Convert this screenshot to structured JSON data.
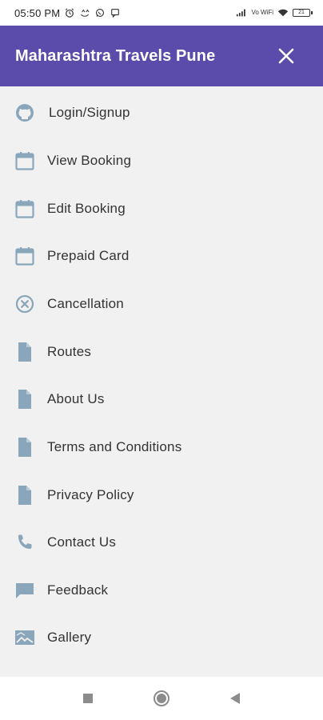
{
  "status_bar": {
    "time": "05:50 PM",
    "network_label": "Vo WiFi",
    "battery_level": "21"
  },
  "app_bar": {
    "title": "Maharashtra Travels Pune",
    "close_icon": "close-icon"
  },
  "colors": {
    "app_bar": "#5b4baa",
    "icon": "#8aa6ba",
    "menu_bg": "#f1f1f1",
    "text": "#333333"
  },
  "menu": {
    "items": [
      {
        "label": "Login/Signup",
        "icon": "github-icon"
      },
      {
        "label": "View Booking",
        "icon": "calendar-icon"
      },
      {
        "label": "Edit Booking",
        "icon": "calendar-icon"
      },
      {
        "label": "Prepaid Card",
        "icon": "calendar-icon"
      },
      {
        "label": "Cancellation",
        "icon": "cancel-circle-icon"
      },
      {
        "label": "Routes",
        "icon": "document-icon"
      },
      {
        "label": "About Us",
        "icon": "document-icon"
      },
      {
        "label": "Terms and Conditions",
        "icon": "document-icon"
      },
      {
        "label": "Privacy Policy",
        "icon": "document-icon"
      },
      {
        "label": "Contact Us",
        "icon": "phone-icon"
      },
      {
        "label": "Feedback",
        "icon": "chat-bubble-icon"
      },
      {
        "label": "Gallery",
        "icon": "image-icon"
      }
    ]
  },
  "nav_bar": {
    "buttons": [
      "recents-square-icon",
      "home-circle-icon",
      "back-triangle-icon"
    ]
  }
}
